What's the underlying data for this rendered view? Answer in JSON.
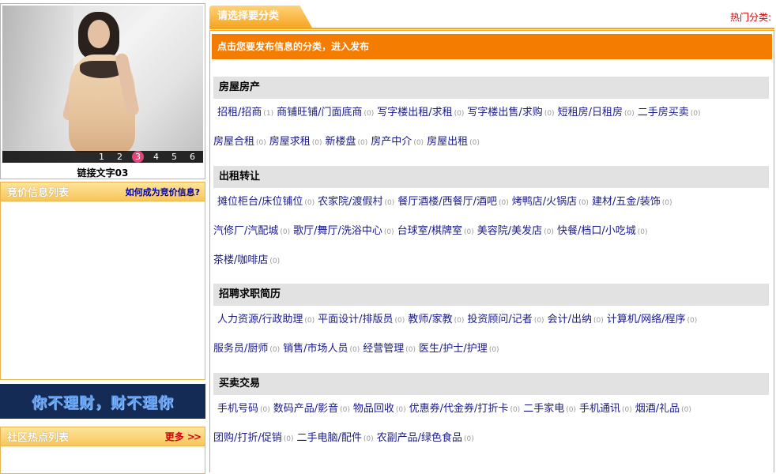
{
  "slideshow": {
    "pages": [
      "1",
      "2",
      "3",
      "4",
      "5",
      "6"
    ],
    "active_page": "3",
    "caption": "链接文字03"
  },
  "bid_box": {
    "title": "竞价信息列表",
    "link": "如何成为竞价信息?"
  },
  "banner": {
    "text": "你不理财，财不理你"
  },
  "community_box": {
    "title": "社区热点列表",
    "more_label": "更多",
    "more_arrows": ">>"
  },
  "main": {
    "tab_label": "请选择要分类",
    "hot_label": "热门分类:",
    "notice": "点击您要发布信息的分类，进入发布"
  },
  "categories": [
    {
      "title": "房屋房产",
      "rows": [
        [
          {
            "label": "招租/招商",
            "count": "(1)"
          },
          {
            "label": "商铺旺铺/门面底商",
            "count": "(0)"
          },
          {
            "label": "写字楼出租/求租",
            "count": "(0)"
          },
          {
            "label": "写字楼出售/求购",
            "count": "(0)"
          },
          {
            "label": "短租房/日租房",
            "count": "(0)"
          },
          {
            "label": "二手房买卖",
            "count": "(0)"
          }
        ],
        [
          {
            "label": "房屋合租",
            "count": "(0)"
          },
          {
            "label": "房屋求租",
            "count": "(0)"
          },
          {
            "label": "新楼盘",
            "count": "(0)"
          },
          {
            "label": "房产中介",
            "count": "(0)"
          },
          {
            "label": "房屋出租",
            "count": "(0)"
          }
        ]
      ]
    },
    {
      "title": "出租转让",
      "rows": [
        [
          {
            "label": "摊位柜台/床位铺位",
            "count": "(0)"
          },
          {
            "label": "农家院/渡假村",
            "count": "(0)"
          },
          {
            "label": "餐厅酒楼/西餐厅/酒吧",
            "count": "(0)"
          },
          {
            "label": "烤鸭店/火锅店",
            "count": "(0)"
          },
          {
            "label": "建材/五金/装饰",
            "count": "(0)"
          }
        ],
        [
          {
            "label": "汽修厂/汽配城",
            "count": "(0)"
          },
          {
            "label": "歌厅/舞厅/洗浴中心",
            "count": "(0)"
          },
          {
            "label": "台球室/棋牌室",
            "count": "(0)"
          },
          {
            "label": "美容院/美发店",
            "count": "(0)"
          },
          {
            "label": "快餐/档口/小吃城",
            "count": "(0)"
          }
        ],
        [
          {
            "label": "茶楼/咖啡店",
            "count": "(0)"
          }
        ]
      ]
    },
    {
      "title": "招聘求职简历",
      "rows": [
        [
          {
            "label": "人力资源/行政助理",
            "count": "(0)"
          },
          {
            "label": "平面设计/排版员",
            "count": "(0)"
          },
          {
            "label": "教师/家教",
            "count": "(0)"
          },
          {
            "label": "投资顾问/记者",
            "count": "(0)"
          },
          {
            "label": "会计/出纳",
            "count": "(0)"
          },
          {
            "label": "计算机/网络/程序",
            "count": "(0)"
          }
        ],
        [
          {
            "label": "服务员/厨师",
            "count": "(0)"
          },
          {
            "label": "销售/市场人员",
            "count": "(0)"
          },
          {
            "label": "经营管理",
            "count": "(0)"
          },
          {
            "label": "医生/护士/护理",
            "count": "(0)"
          }
        ]
      ]
    },
    {
      "title": "买卖交易",
      "rows": [
        [
          {
            "label": "手机号码",
            "count": "(0)"
          },
          {
            "label": "数码产品/影音",
            "count": "(0)"
          },
          {
            "label": "物品回收",
            "count": "(0)"
          },
          {
            "label": "优惠券/代金券/打折卡",
            "count": "(0)"
          },
          {
            "label": "二手家电",
            "count": "(0)"
          },
          {
            "label": "手机通讯",
            "count": "(0)"
          },
          {
            "label": "烟酒/礼品",
            "count": "(0)"
          }
        ],
        [
          {
            "label": "团购/打折/促销",
            "count": "(0)"
          },
          {
            "label": "二手电脑/配件",
            "count": "(0)"
          },
          {
            "label": "农副产品/绿色食品",
            "count": "(0)"
          }
        ]
      ]
    }
  ]
}
